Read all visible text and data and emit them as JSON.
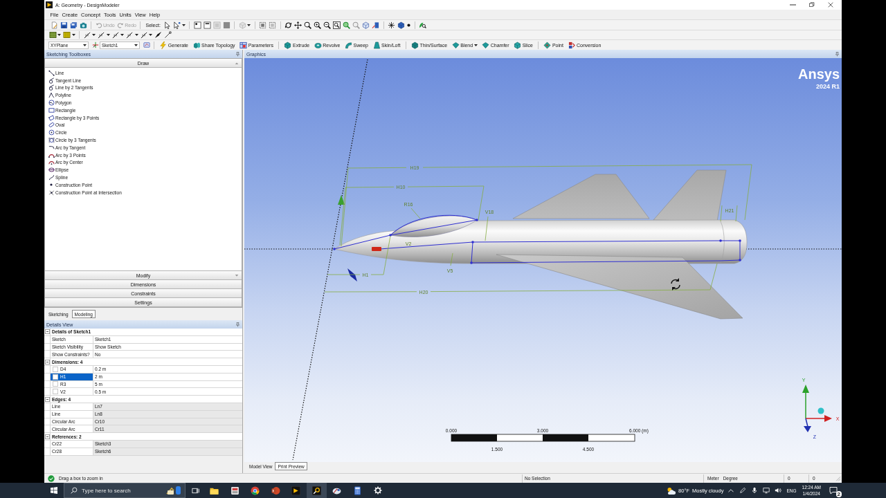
{
  "window": {
    "title": "A: Geometry - DesignModeler"
  },
  "menu": [
    "File",
    "Create",
    "Concept",
    "Tools",
    "Units",
    "View",
    "Help"
  ],
  "toolbar": {
    "undo": {
      "label": "Undo",
      "disabled": true
    },
    "redo": {
      "label": "Redo",
      "disabled": true
    },
    "select_label": "Select:"
  },
  "sketch_bar": {
    "plane": "XYPlane",
    "sketch": "Sketch1",
    "groups": [
      {
        "buttons": [
          {
            "label": "Generate",
            "dropdown": false
          },
          {
            "label": "Share Topology",
            "dropdown": false
          },
          {
            "label": "Parameters",
            "dropdown": false
          }
        ]
      },
      {
        "buttons": [
          {
            "label": "Extrude",
            "dropdown": false
          },
          {
            "label": "Revolve",
            "dropdown": false
          },
          {
            "label": "Sweep",
            "dropdown": false
          },
          {
            "label": "Skin/Loft",
            "dropdown": false
          }
        ]
      },
      {
        "buttons": [
          {
            "label": "Thin/Surface",
            "dropdown": false
          },
          {
            "label": "Blend",
            "dropdown": true
          },
          {
            "label": "Chamfer",
            "dropdown": false
          },
          {
            "label": "Slice",
            "dropdown": false
          }
        ]
      },
      {
        "buttons": [
          {
            "label": "Point",
            "dropdown": false
          },
          {
            "label": "Conversion",
            "dropdown": false
          }
        ]
      }
    ]
  },
  "toolboxes": {
    "title": "Sketching Toolboxes",
    "sections": [
      {
        "label": "Draw",
        "expanded": true,
        "tools": [
          "Line",
          "Tangent Line",
          "Line by 2 Tangents",
          "Polyline",
          "Polygon",
          "Rectangle",
          "Rectangle by 3 Points",
          "Oval",
          "Circle",
          "Circle by 3 Tangents",
          "Arc by Tangent",
          "Arc by 3 Points",
          "Arc by Center",
          "Ellipse",
          "Spline",
          "Construction Point",
          "Construction Point at Intersection"
        ]
      },
      {
        "label": "Modify",
        "expanded": false
      },
      {
        "label": "Dimensions",
        "expanded": false
      },
      {
        "label": "Constraints",
        "expanded": false
      },
      {
        "label": "Settings",
        "expanded": false
      }
    ]
  },
  "panel_tabs": [
    {
      "label": "Sketching",
      "selected": true
    },
    {
      "label": "Modeling",
      "selected": false
    }
  ],
  "details": {
    "title": "Details View",
    "groups": [
      {
        "label": "Details of Sketch1",
        "expanded": true,
        "rows": [
          {
            "kind": "property",
            "name": "Sketch",
            "value": "Sketch1"
          },
          {
            "kind": "property",
            "name": "Sketch Visibility",
            "value": "Show Sketch"
          },
          {
            "kind": "property",
            "name": "Show Constraints?",
            "value": "No"
          }
        ]
      },
      {
        "label": "Dimensions: 4",
        "expanded": true,
        "rows": [
          {
            "kind": "dimension",
            "name": "D4",
            "value": "0.2 m",
            "checked": false,
            "selected": false
          },
          {
            "kind": "dimension",
            "name": "H1",
            "value": "2 m",
            "checked": false,
            "selected": true
          },
          {
            "kind": "dimension",
            "name": "R3",
            "value": "5 m",
            "checked": false,
            "selected": false
          },
          {
            "kind": "dimension",
            "name": "V2",
            "value": "0.5 m",
            "checked": false,
            "selected": false
          }
        ]
      },
      {
        "label": "Edges: 4",
        "expanded": true,
        "rows": [
          {
            "kind": "readonly",
            "name": "Line",
            "value": "Ln7"
          },
          {
            "kind": "readonly",
            "name": "Line",
            "value": "Ln8"
          },
          {
            "kind": "readonly",
            "name": "Circular Arc",
            "value": "Cr10"
          },
          {
            "kind": "readonly",
            "name": "Circular Arc",
            "value": "Cr11"
          }
        ]
      },
      {
        "label": "References: 2",
        "expanded": true,
        "rows": [
          {
            "kind": "readonly",
            "name": "Cr22",
            "value": "Sketch3"
          },
          {
            "kind": "readonly",
            "name": "Cr28",
            "value": "Sketch6"
          }
        ]
      }
    ]
  },
  "graphics": {
    "title": "Graphics",
    "logo": {
      "brand": "Ansys",
      "version": "2024 R1"
    },
    "dimension_labels": [
      "H19",
      "H10",
      "R16",
      "V18",
      "H21",
      "V2",
      "V5",
      "H1",
      "H20"
    ],
    "scale_bar": {
      "top_labels": [
        "0.000",
        "3.000",
        "6.000 (m)"
      ],
      "bottom_labels": [
        "1.500",
        "4.500"
      ]
    },
    "triad_axes": [
      "Y",
      "X",
      "Z"
    ],
    "view_tabs": [
      {
        "label": "Model View",
        "selected": true
      },
      {
        "label": "Print Preview",
        "selected": false
      }
    ]
  },
  "status_bar": {
    "message": "Drag a box to zoom in",
    "selection": "No Selection",
    "length_unit": "Meter",
    "angle_unit": "Degree",
    "values": [
      "0",
      "0"
    ]
  },
  "taskbar": {
    "search": {
      "placeholder": "Type here to search"
    },
    "apps": [
      {
        "active": false
      },
      {
        "active": false
      },
      {
        "active": false
      },
      {
        "active": false
      },
      {
        "active": false
      },
      {
        "active": true
      },
      {
        "active": false
      },
      {
        "active": false
      },
      {
        "active": false
      }
    ],
    "weather": {
      "temperature": "80°F",
      "condition": "Mostly cloudy"
    },
    "language": "ENG",
    "time": "12:24 AM",
    "date": "1/4/2024",
    "notification_count": "2"
  }
}
